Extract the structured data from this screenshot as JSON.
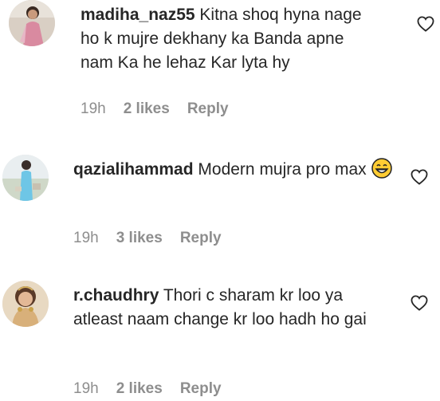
{
  "comments": [
    {
      "username": "madiha_naz55",
      "text": "Kitna shoq hyna nage ho k mujre dekhany ka Banda apne nam Ka he lehaz Kar lyta hy",
      "time": "19h",
      "likes": "2 likes",
      "reply": "Reply"
    },
    {
      "username": "qazialihammad",
      "text": "Modern mujra pro max",
      "time": "19h",
      "likes": "3 likes",
      "reply": "Reply"
    },
    {
      "username": "r.chaudhry",
      "text": "Thori c sharam kr loo ya atleast naam change kr loo hadh ho gai",
      "time": "19h",
      "likes": "2 likes",
      "reply": "Reply"
    }
  ],
  "icons": {
    "like": "heart-outline-icon",
    "emoji": "grinning-face-emoji"
  }
}
